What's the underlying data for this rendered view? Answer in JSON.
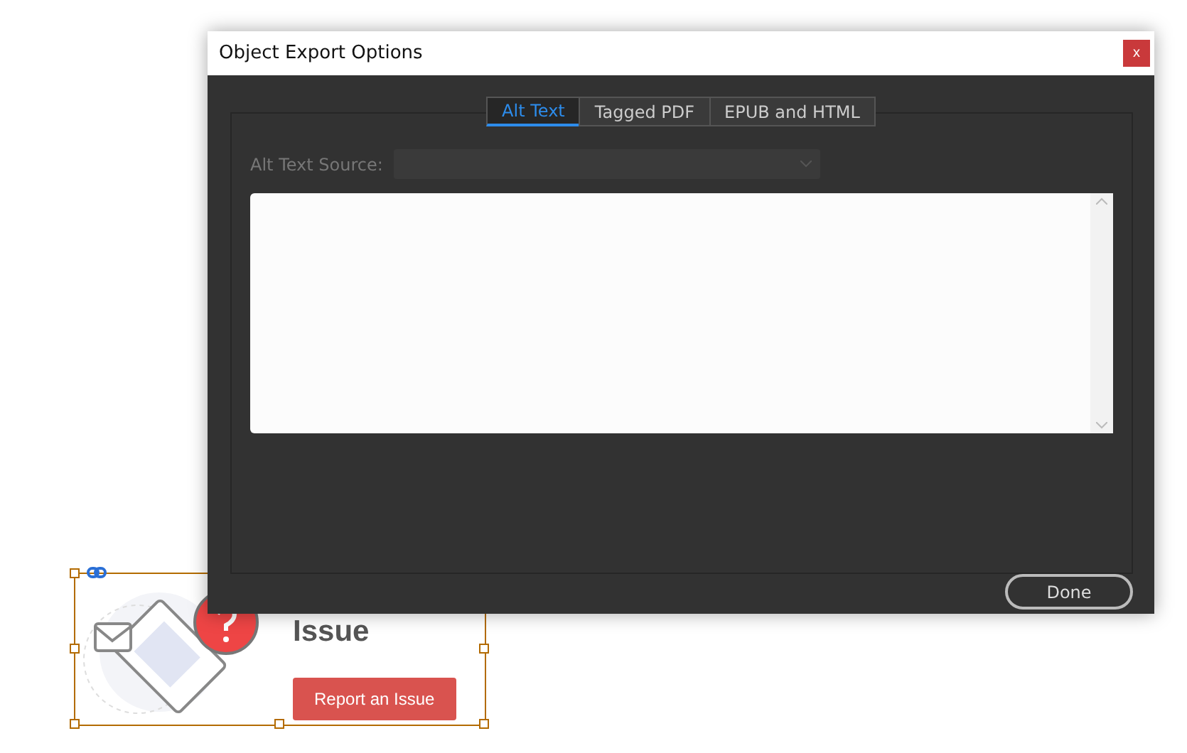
{
  "canvas": {
    "heading": "Issue",
    "button": "Report an Issue",
    "selected": true
  },
  "dialog": {
    "title": "Object Export Options",
    "close": "x",
    "tabs": [
      {
        "label": "Alt Text",
        "selected": true
      },
      {
        "label": "Tagged PDF",
        "selected": false
      },
      {
        "label": "EPUB and HTML",
        "selected": false
      }
    ],
    "source": {
      "label": "Alt Text Source:",
      "disabled": true
    },
    "buttons": [
      "Done"
    ]
  }
}
